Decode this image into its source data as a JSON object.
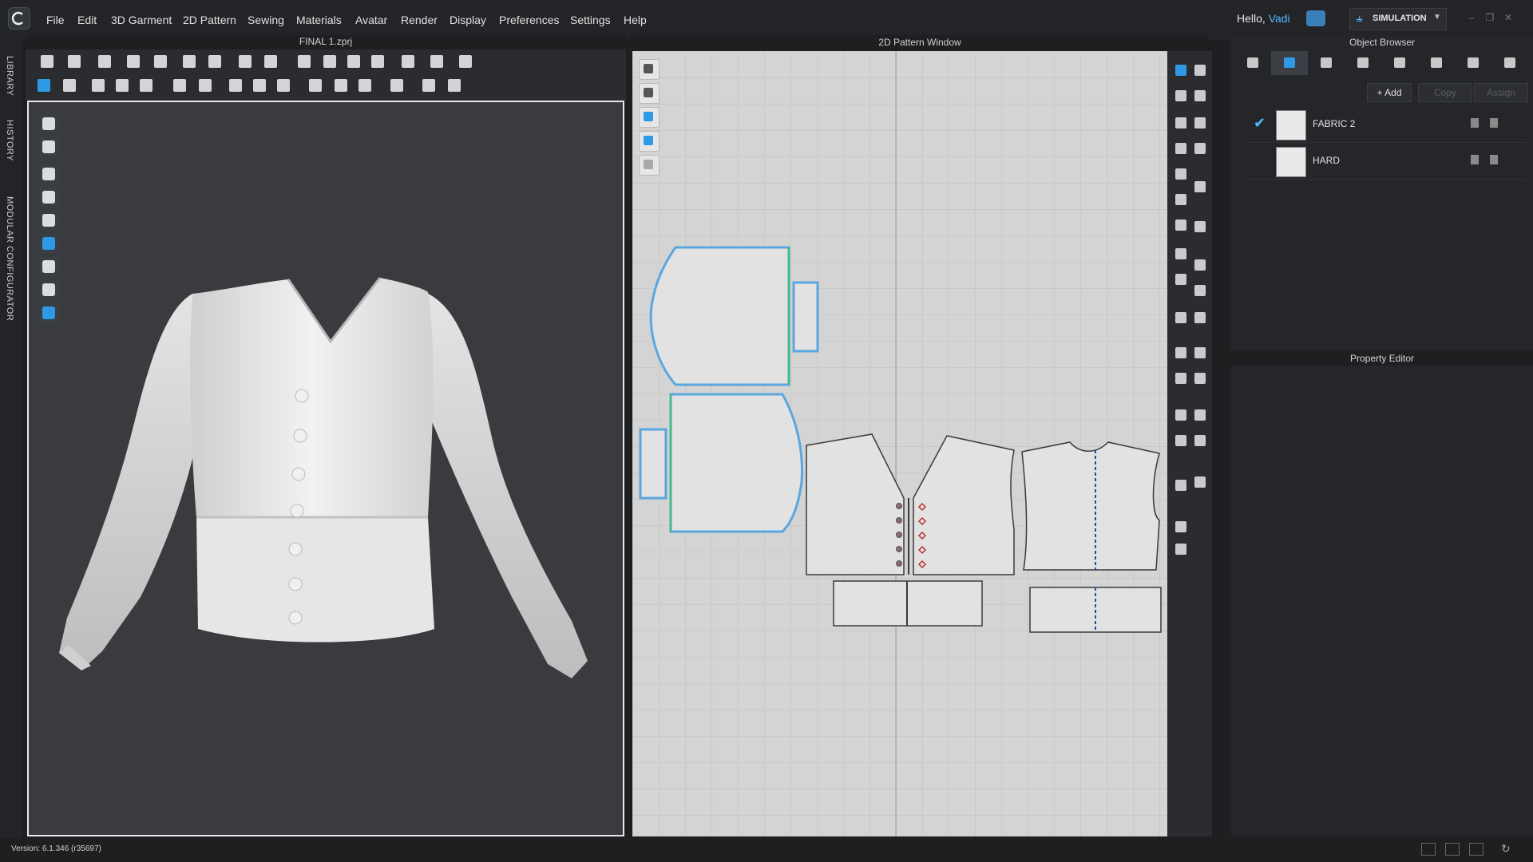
{
  "menu": [
    "File",
    "Edit",
    "3D Garment",
    "2D Pattern",
    "Sewing",
    "Materials",
    "Avatar",
    "Render",
    "Display",
    "Preferences",
    "Settings",
    "Help"
  ],
  "header": {
    "greeting": "Hello,",
    "user": "Vadi",
    "mode": "SIMULATION"
  },
  "side_tabs": [
    "LIBRARY",
    "HISTORY",
    "MODULAR CONFIGURATOR"
  ],
  "window3d": {
    "title": "FINAL 1.zprj"
  },
  "window2d": {
    "title": "2D Pattern Window"
  },
  "object_browser": {
    "title": "Object Browser",
    "add_label": "+ Add",
    "copy_label": "Copy",
    "assign_label": "Assign",
    "fabrics": [
      {
        "name": "FABRIC 2",
        "checked": true,
        "swatch_color": "#e9e9e9"
      },
      {
        "name": "HARD",
        "checked": false,
        "swatch_color": "#e9e9e9"
      }
    ]
  },
  "property_editor": {
    "title": "Property Editor"
  },
  "status": {
    "version": "Version: 6.1.346 (r35697)"
  },
  "colors": {
    "accent": "#4fb8ff",
    "selected_outline": "#5aa7e0",
    "seam_green": "#3fbf6a",
    "button_red": "#b8322f"
  }
}
